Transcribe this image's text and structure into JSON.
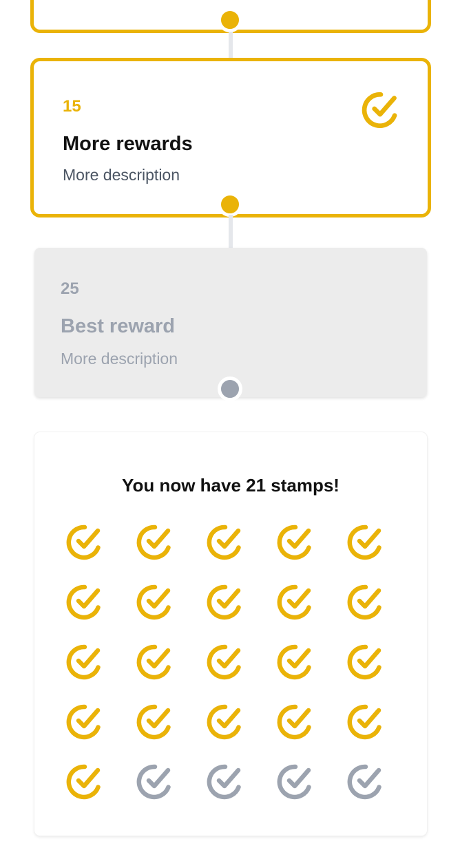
{
  "colors": {
    "accent": "#EAB308",
    "inactive": "#9ca3af",
    "locked_bg": "#ececec",
    "connector": "#e5e7eb"
  },
  "rewards": [
    {
      "number": "15",
      "title": "More rewards",
      "description": "More description",
      "status": "achieved",
      "icon": "check-circle-icon"
    },
    {
      "number": "25",
      "title": "Best reward",
      "description": "More description",
      "status": "locked"
    }
  ],
  "stamp_card": {
    "title": "You now have 21 stamps!",
    "collected": 21,
    "total": 25,
    "icon": "check-circle-icon"
  }
}
